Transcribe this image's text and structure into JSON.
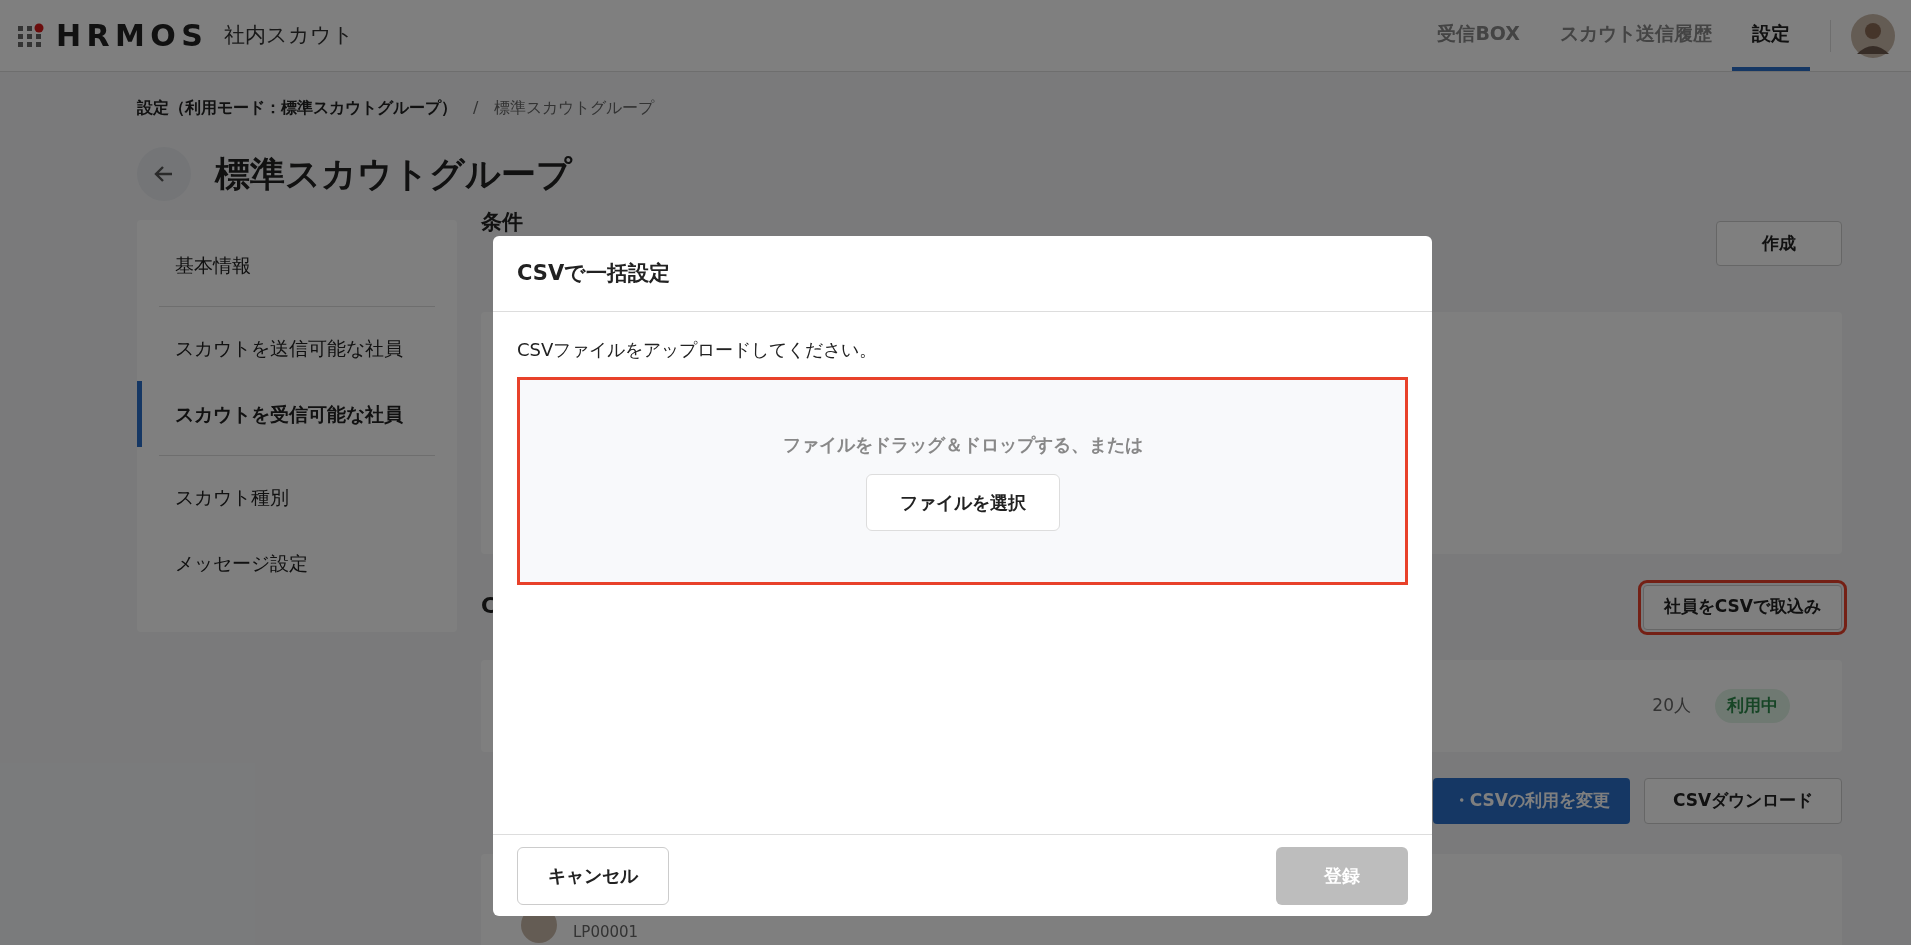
{
  "header": {
    "logo": "HRMOS",
    "product": "社内スカウト",
    "nav": [
      {
        "label": "受信BOX",
        "selected": false
      },
      {
        "label": "スカウト送信履歴",
        "selected": false
      },
      {
        "label": "設定",
        "selected": true
      }
    ]
  },
  "breadcrumb": {
    "parent": "設定（利用モード：標準スカウトグループ）",
    "separator": "/",
    "current": "標準スカウトグループ"
  },
  "page_title": "標準スカウトグループ",
  "sidebar": {
    "items": [
      {
        "label": "基本情報",
        "selected": false
      },
      {
        "label": "スカウトを送信可能な社員",
        "selected": false
      },
      {
        "label": "スカウトを受信可能な社員",
        "selected": true
      },
      {
        "label": "スカウト種別",
        "selected": false
      },
      {
        "label": "メッセージ設定",
        "selected": false
      }
    ]
  },
  "content": {
    "section_1_heading": "条件",
    "create_button": "作成",
    "section_2_heading": "C",
    "import_button": {
      "label": "社員をCSVで取込み",
      "highlighted": true
    },
    "count": "20人",
    "status_badge": "利用中",
    "change_button": "・CSVの利用を変更",
    "download_button": "CSVダウンロード",
    "employee_id": "LP00001"
  },
  "dialog": {
    "title": "CSVで一括設定",
    "instruction": "CSVファイルをアップロードしてください。",
    "dropzone": {
      "text": "ファイルをドラッグ＆ドロップする、または",
      "button": "ファイルを選択",
      "highlighted": true
    },
    "cancel_button": "キャンセル",
    "submit_button": {
      "label": "登録",
      "disabled": true
    }
  }
}
